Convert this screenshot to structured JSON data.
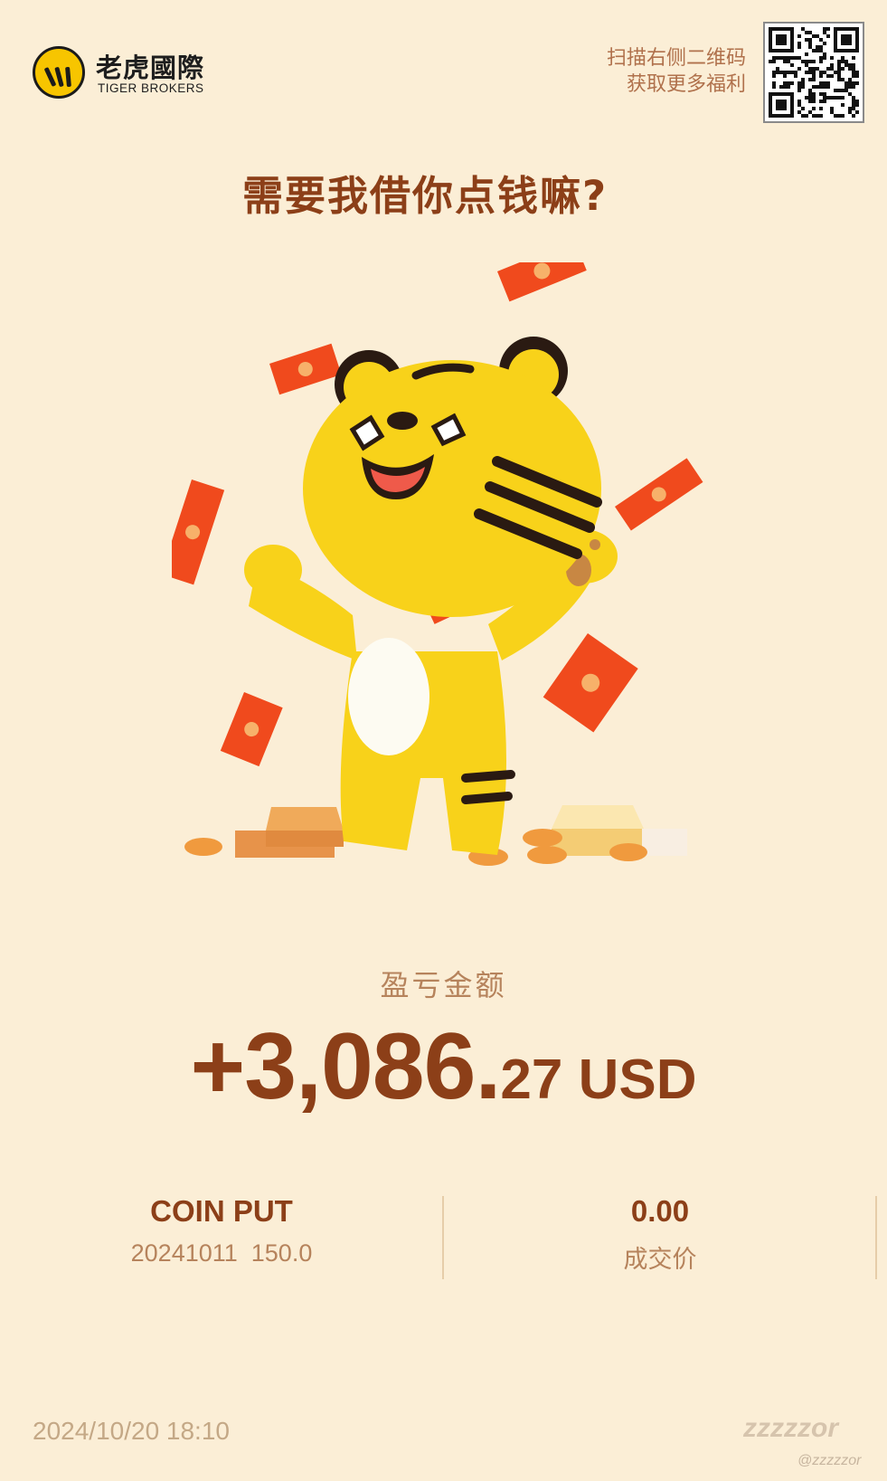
{
  "brand": {
    "name_cn": "老虎國際",
    "name_en": "TIGER BROKERS"
  },
  "promo": {
    "line1": "扫描右侧二维码",
    "line2": "获取更多福利"
  },
  "headline": "需要我借你点钱嘛?",
  "pnl": {
    "label": "盈亏金额",
    "amount_main": "+3,086.",
    "amount_decimal": "27 USD"
  },
  "position": {
    "name": "COIN PUT",
    "detail": "20241011  150.0"
  },
  "trade": {
    "price": "0.00",
    "price_label": "成交价"
  },
  "timestamp": "2024/10/20 18:10",
  "watermark": "zzzzzor",
  "handle": "@zzzzzor",
  "colors": {
    "background": "#fbeed6",
    "accent_brown": "#8c3f18",
    "muted_brown": "#b6835c",
    "tiger_yellow": "#f8d21a",
    "envelope_red": "#f04a1d"
  },
  "icons": [
    "tiger-logo-icon",
    "qr-code-icon",
    "tiger-mascot-illustration"
  ]
}
